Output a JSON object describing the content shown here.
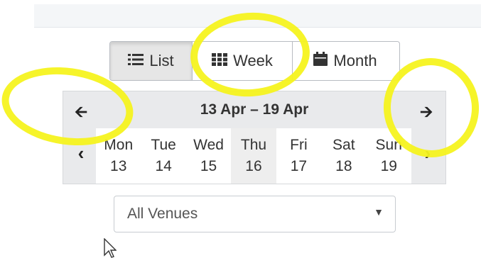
{
  "views": [
    {
      "label": "List",
      "icon": "list-icon",
      "active": true
    },
    {
      "label": "Week",
      "icon": "grid-icon",
      "active": false
    },
    {
      "label": "Month",
      "icon": "calendar-icon",
      "active": false
    }
  ],
  "calendar": {
    "range": "13 Apr – 19 Apr",
    "prev_week_icon": "arrow-left-icon",
    "next_week_icon": "arrow-right-icon",
    "prev_day_icon": "chevron-left-icon",
    "next_day_icon": "chevron-right-icon",
    "days": [
      {
        "name": "Mon",
        "date": "13"
      },
      {
        "name": "Tue",
        "date": "14"
      },
      {
        "name": "Wed",
        "date": "15"
      },
      {
        "name": "Thu",
        "date": "16"
      },
      {
        "name": "Fri",
        "date": "17"
      },
      {
        "name": "Sat",
        "date": "18"
      },
      {
        "name": "Sun",
        "date": "19"
      }
    ]
  },
  "venue_select": {
    "value": "All Venues"
  },
  "colors": {
    "highlight": "#f5f31f",
    "active_button": "#e6e6e6",
    "calendar_bg": "#e9eaec"
  }
}
